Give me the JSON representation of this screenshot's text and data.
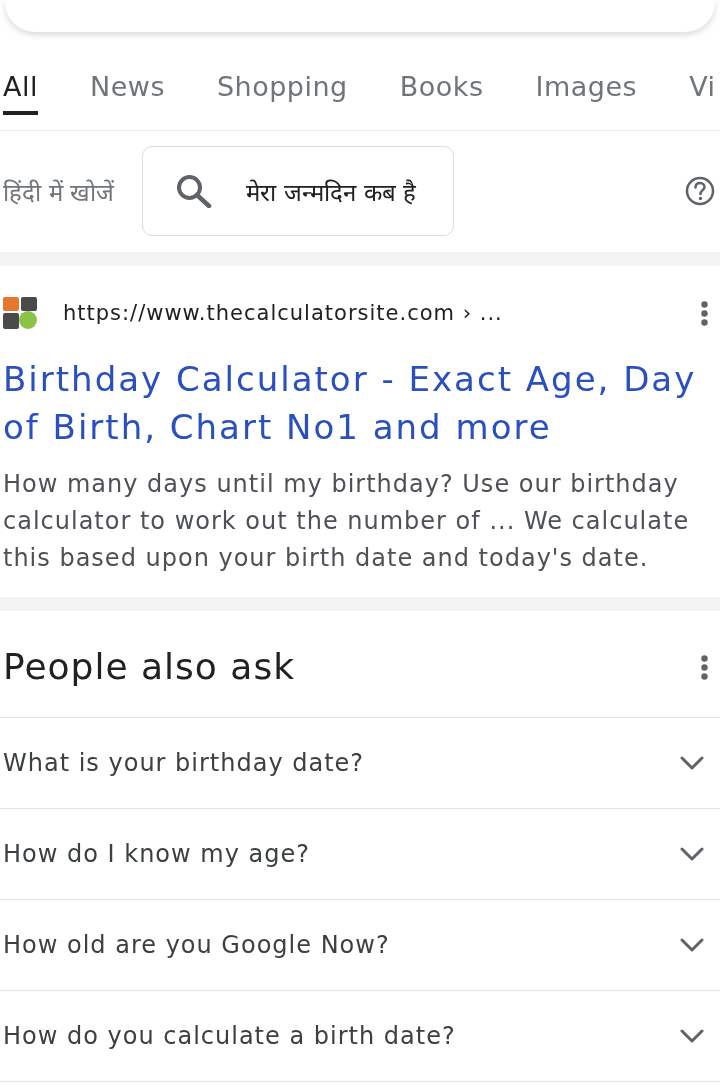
{
  "tabs": [
    {
      "label": "All",
      "selected": true
    },
    {
      "label": "News",
      "selected": false
    },
    {
      "label": "Shopping",
      "selected": false
    },
    {
      "label": "Books",
      "selected": false
    },
    {
      "label": "Images",
      "selected": false
    },
    {
      "label": "Vi",
      "selected": false
    }
  ],
  "hindi_search": {
    "label": "हिंदी में खोजें",
    "query": "मेरा जन्मदिन कब है"
  },
  "result": {
    "url": "https://www.thecalculatorsite.com › ...",
    "title": "Birthday Calculator - Exact Age, Day of Birth, Chart No1 and more",
    "snippet": "How many days until my birthday? Use our birthday calculator to work out the number of ... We calculate this based upon your birth date and today's date."
  },
  "people_also_ask": {
    "title": "People also ask",
    "questions": [
      {
        "text": "What is your birthday date?",
        "expanded": false
      },
      {
        "text": "How do I know my age?",
        "expanded": false
      },
      {
        "text": "How old are you Google Now?",
        "expanded": false
      },
      {
        "text": "How do you calculate a birth date?",
        "expanded": false
      }
    ]
  }
}
